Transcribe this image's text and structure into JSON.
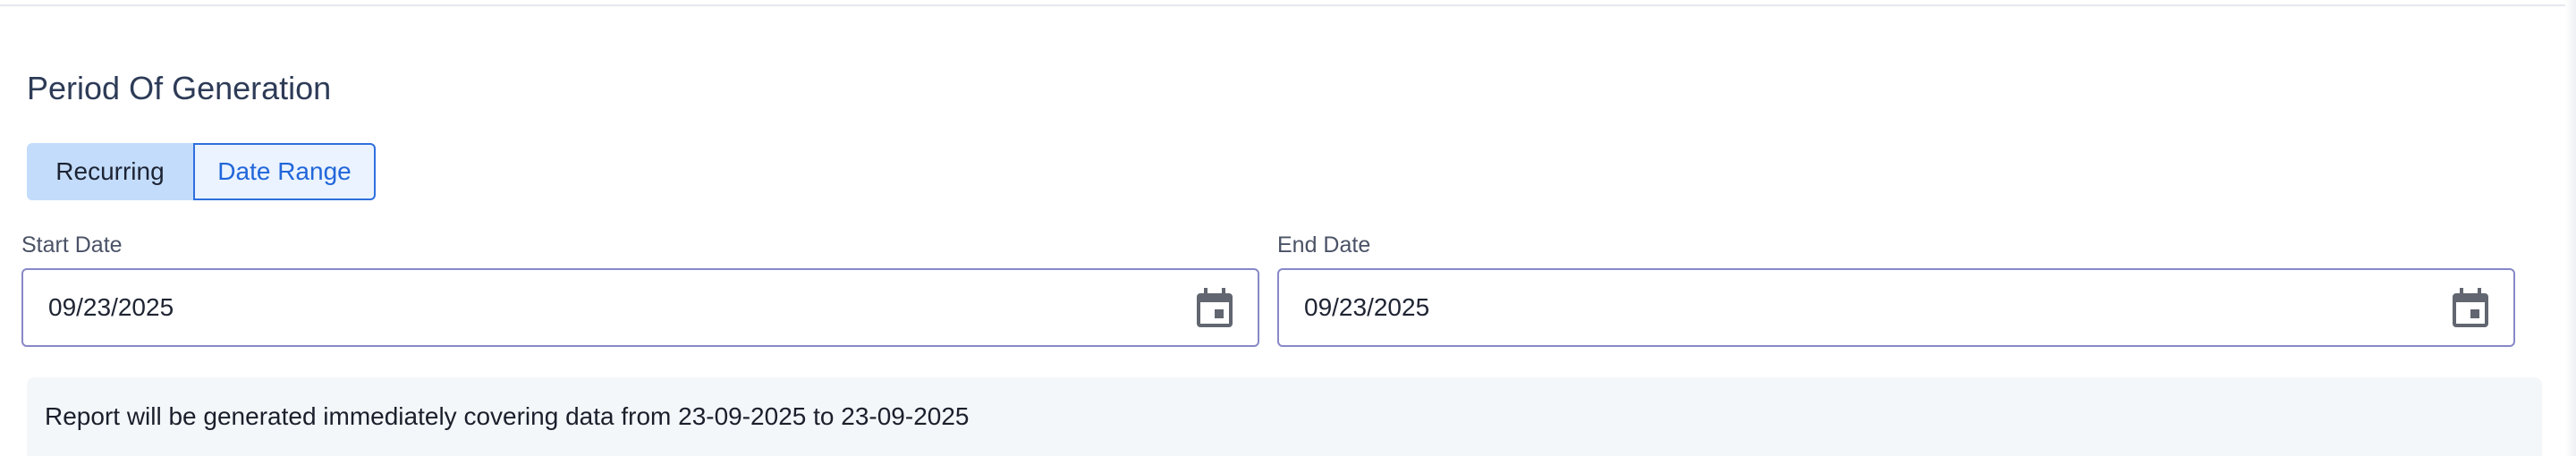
{
  "section": {
    "title": "Period Of Generation"
  },
  "toggle": {
    "recurring_label": "Recurring",
    "date_range_label": "Date Range",
    "selected": "Date Range"
  },
  "start_date": {
    "label": "Start Date",
    "value": "09/23/2025",
    "icon": "calendar-icon"
  },
  "end_date": {
    "label": "End Date",
    "value": "09/23/2025",
    "icon": "calendar-icon"
  },
  "info": {
    "text": "Report will be generated immediately covering data from 23-09-2025 to 23-09-2025"
  },
  "colors": {
    "title": "#2d3b57",
    "toggle_inactive_bg": "#c3dcfb",
    "toggle_active_border": "#2f6fde",
    "toggle_active_text": "#2166d9",
    "field_border": "#8888c8",
    "info_bg": "#f4f7fa"
  }
}
